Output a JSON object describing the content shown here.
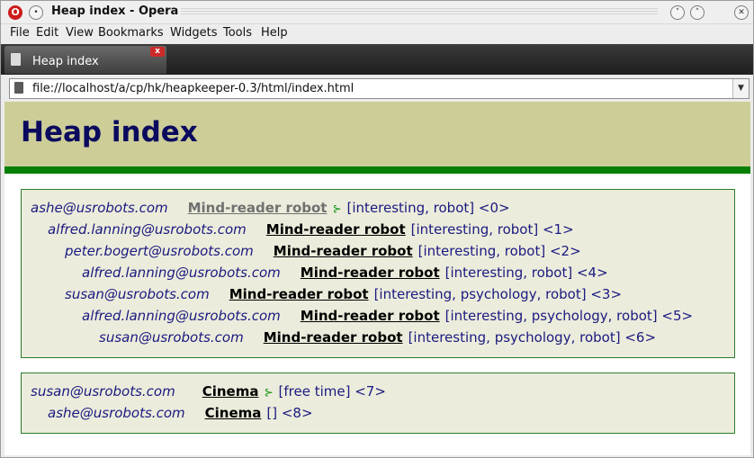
{
  "window": {
    "title": "Heap index - Opera",
    "logo": "O"
  },
  "menu": [
    "File",
    "Edit",
    "View",
    "Bookmarks",
    "Widgets",
    "Tools",
    "Help"
  ],
  "tab": {
    "label": "Heap index",
    "close_label": "x"
  },
  "address": {
    "url": "file://localhost/a/cp/hk/heapkeeper-0.3/html/index.html"
  },
  "page": {
    "title": "Heap index",
    "threads": [
      {
        "posts": [
          {
            "author": "ashe@usrobots.com",
            "subject": "Mind-reader robot",
            "tree_icon": "⊱",
            "tags": "[interesting, robot] <0>"
          },
          {
            "author": "alfred.lanning@usrobots.com",
            "subject": "Mind-reader robot",
            "tags": "[interesting, robot] <1>"
          },
          {
            "author": "peter.bogert@usrobots.com",
            "subject": "Mind-reader robot",
            "tags": "[interesting, robot] <2>"
          },
          {
            "author": "alfred.lanning@usrobots.com",
            "subject": "Mind-reader robot",
            "tags": "[interesting, robot] <4>"
          },
          {
            "author": "susan@usrobots.com",
            "subject": "Mind-reader robot",
            "tags": "[interesting, psychology, robot] <3>"
          },
          {
            "author": "alfred.lanning@usrobots.com",
            "subject": "Mind-reader robot",
            "tags": "[interesting, psychology, robot] <5>"
          },
          {
            "author": "susan@usrobots.com",
            "subject": "Mind-reader robot",
            "tags": "[interesting, psychology, robot] <6>"
          }
        ]
      },
      {
        "posts": [
          {
            "author": "susan@usrobots.com",
            "subject": "Cinema",
            "tree_icon": "⊱",
            "tags": "[free time] <7>"
          },
          {
            "author": "ashe@usrobots.com",
            "subject": "Cinema",
            "tags": "[] <8>"
          }
        ]
      }
    ]
  },
  "colors": {
    "header_bg": "#cdcd98",
    "green_bar": "#058005",
    "thread_bg": "#ececdc",
    "title": "#0a0a5e"
  }
}
